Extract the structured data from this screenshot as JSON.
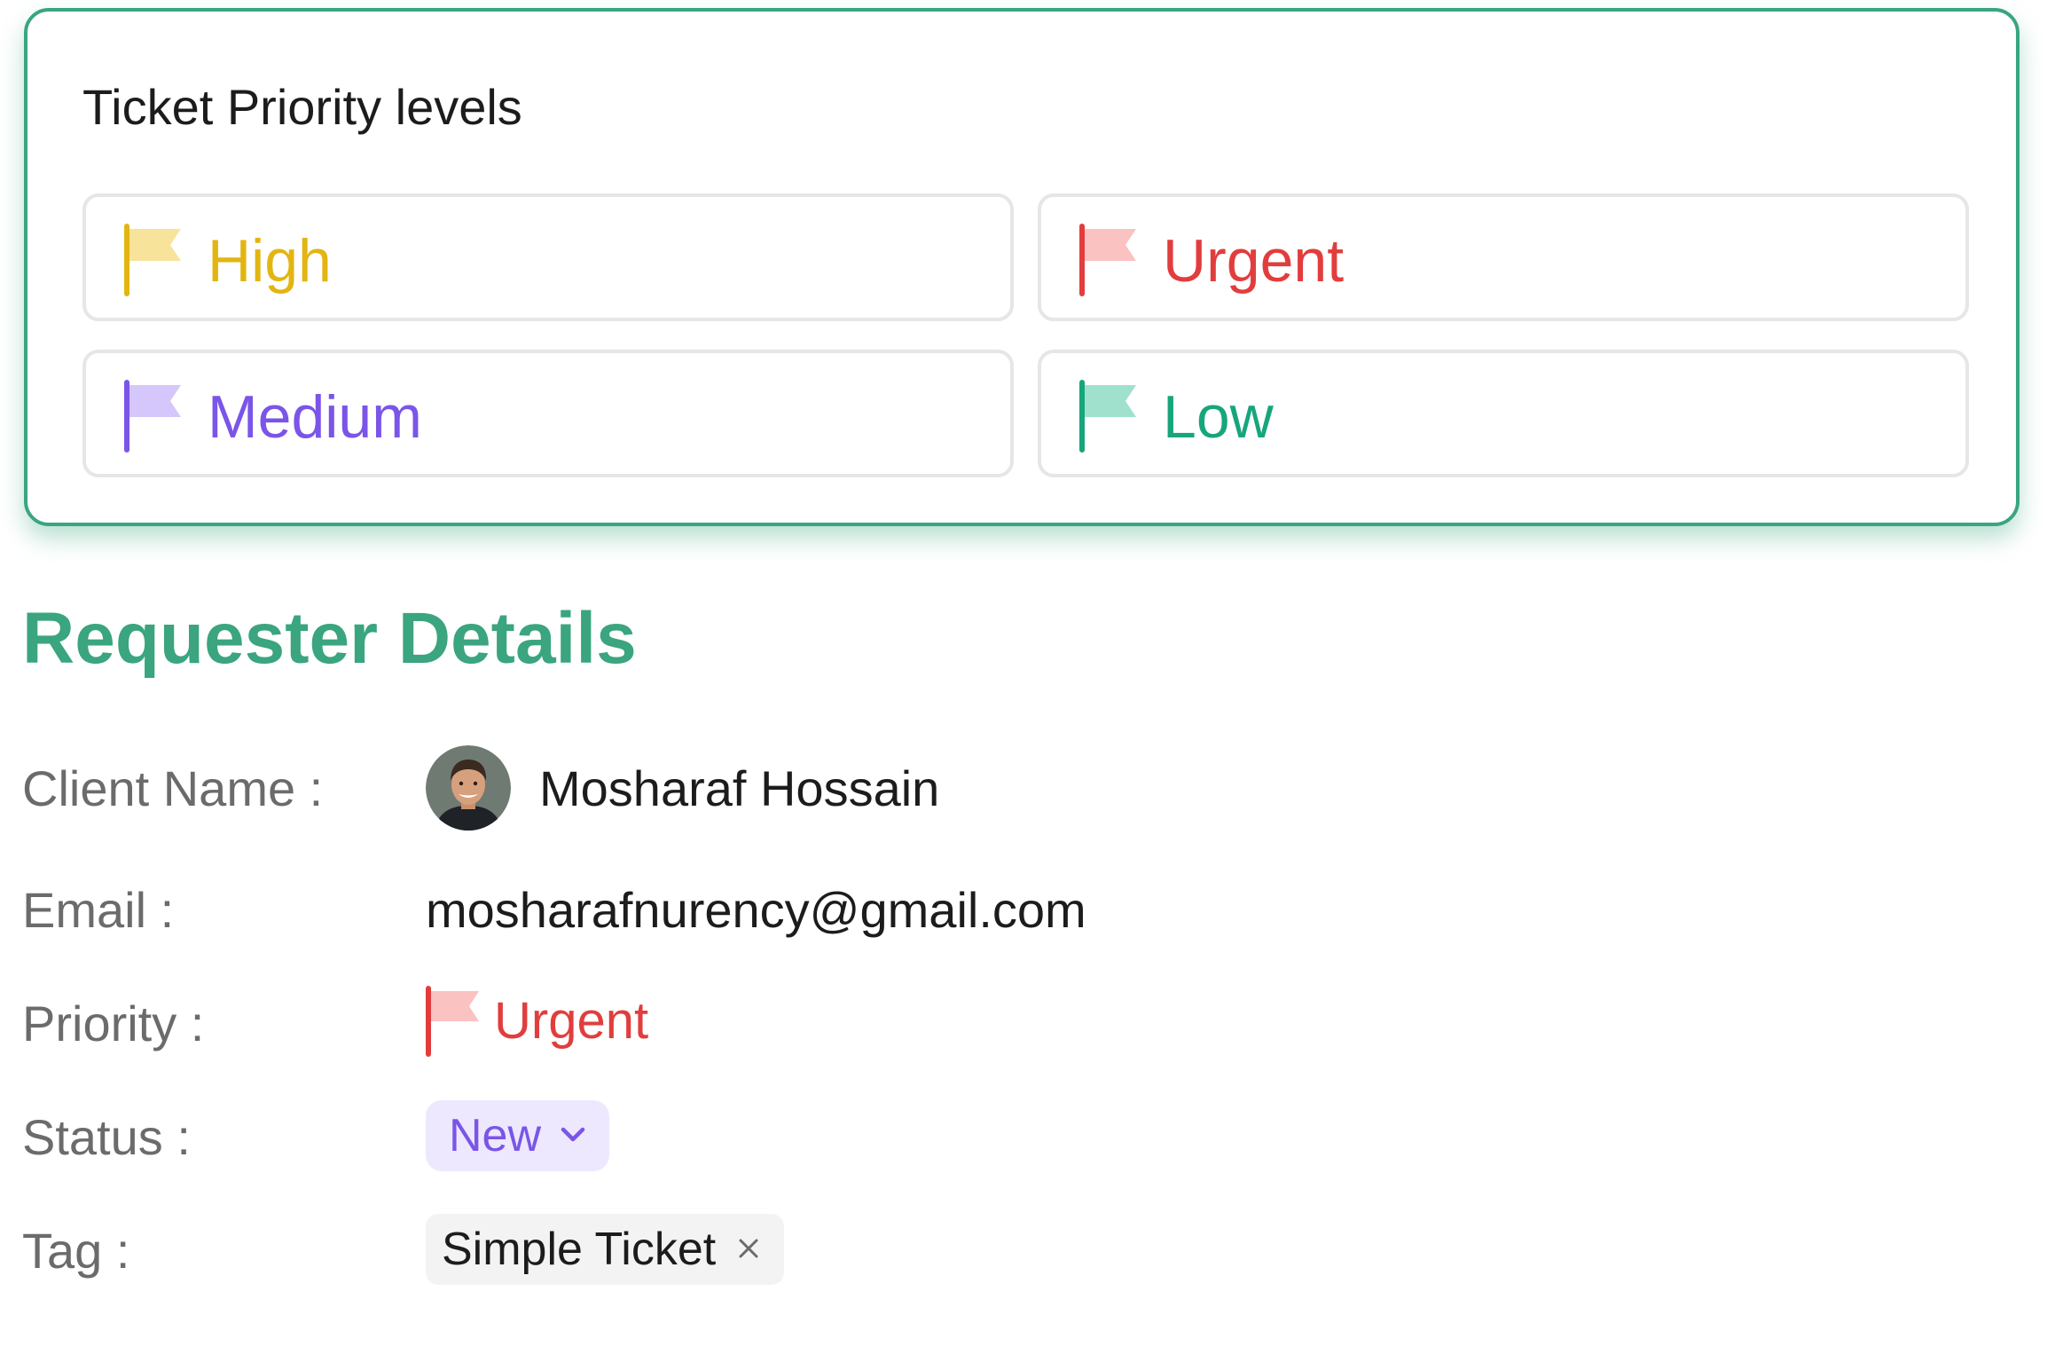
{
  "priority_card": {
    "title": "Ticket Priority levels",
    "levels": [
      {
        "label": "High",
        "icon": "flag-icon",
        "text_color": "#e2b512",
        "flag_pole": "#e2b512",
        "flag_fill": "#f8e39b"
      },
      {
        "label": "Urgent",
        "icon": "flag-icon",
        "text_color": "#e23d3d",
        "flag_pole": "#e23d3d",
        "flag_fill": "#fbc2c2"
      },
      {
        "label": "Medium",
        "icon": "flag-icon",
        "text_color": "#7a55e8",
        "flag_pole": "#7a55e8",
        "flag_fill": "#d5c6fb"
      },
      {
        "label": "Low",
        "icon": "flag-icon",
        "text_color": "#17a57c",
        "flag_pole": "#17a57c",
        "flag_fill": "#9fe1cc"
      }
    ]
  },
  "requester": {
    "title": "Requester Details",
    "accent_color": "#3aa57e",
    "client_name_label": "Client Name :",
    "client_name": "Mosharaf Hossain",
    "email_label": "Email :",
    "email": "mosharafnurency@gmail.com",
    "priority_label": "Priority :",
    "priority": "Urgent",
    "priority_color": "#e23d3d",
    "status_label": "Status :",
    "status": "New",
    "status_color": "#7a55e8",
    "tag_label": "Tag :",
    "tag": "Simple Ticket"
  }
}
